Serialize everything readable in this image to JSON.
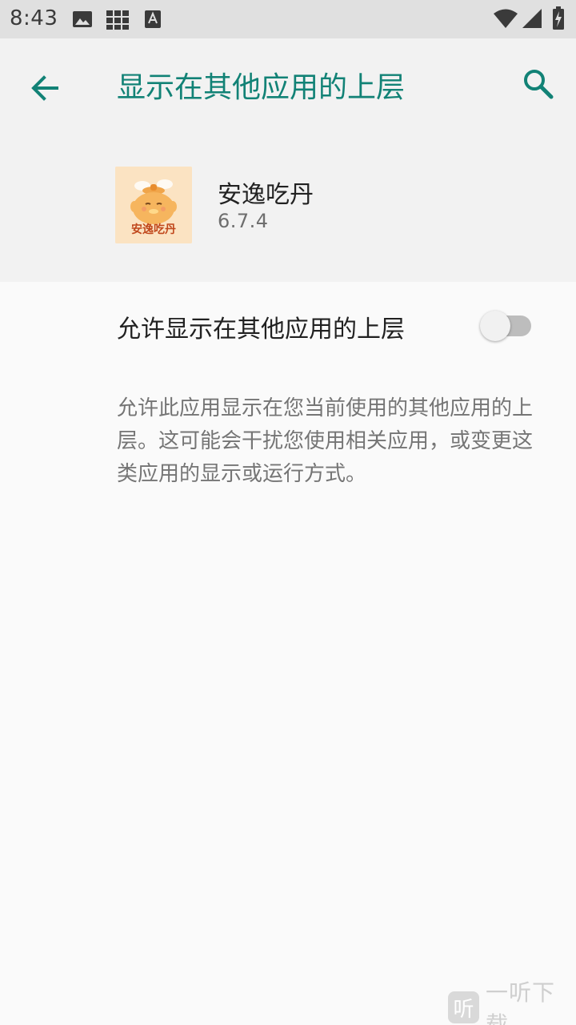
{
  "status_bar": {
    "time": "8:43",
    "icons": [
      "image-icon",
      "grid-icon",
      "a-notification-icon",
      "wifi-icon",
      "signal-icon",
      "battery-charging-icon"
    ]
  },
  "toolbar": {
    "title": "显示在其他应用的上层",
    "back_icon": "arrow-back-icon",
    "search_icon": "search-icon",
    "accent_color": "#128276"
  },
  "app": {
    "name": "安逸吃丹",
    "version": "6.7.4",
    "icon_label": "安逸吃丹"
  },
  "setting": {
    "label": "允许显示在其他应用的上层",
    "enabled": false
  },
  "description": "允许此应用显示在您当前使用的其他应用的上层。这可能会干扰您使用相关应用，或变更这类应用的显示或运行方式。",
  "watermark": {
    "logo_char": "听",
    "text": "一听下载"
  }
}
